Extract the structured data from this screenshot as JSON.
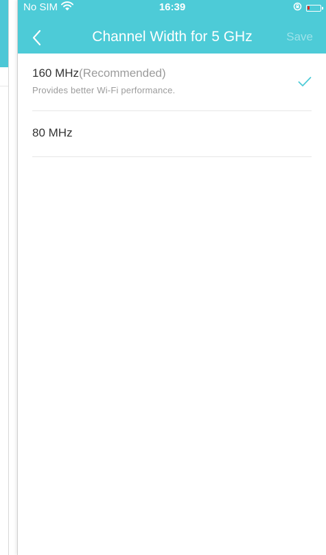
{
  "status_bar": {
    "carrier": "No SIM",
    "time": "16:39"
  },
  "header": {
    "title": "Channel Width for 5 GHz",
    "save_label": "Save"
  },
  "options": [
    {
      "label": "160 MHz",
      "tag": "(Recommended)",
      "description": "Provides better Wi-Fi performance.",
      "selected": true
    },
    {
      "label": "80 MHz",
      "selected": false
    }
  ],
  "colors": {
    "accent": "#4dcbd7",
    "text": "#333333",
    "secondary_text": "#9b9b9b",
    "divider": "#e6e6e6",
    "battery_low": "#e2231a"
  },
  "icons": {
    "back": "chevron-left-icon",
    "wifi": "wifi-icon",
    "orientation_lock": "orientation-lock-icon",
    "battery": "battery-icon",
    "selected": "checkmark-icon"
  }
}
